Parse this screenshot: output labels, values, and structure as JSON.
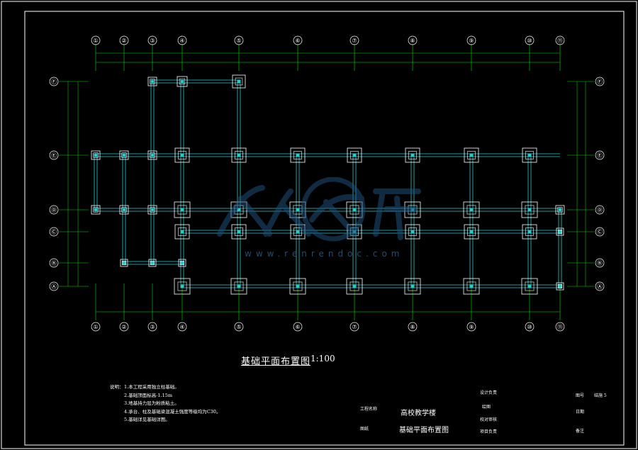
{
  "drawing": {
    "title": "基础平面布置图",
    "scale": "1:100",
    "col_axes": [
      "①",
      "②",
      "③",
      "④",
      "⑤",
      "⑥",
      "⑦",
      "⑧",
      "⑨",
      "⑩",
      "⑪"
    ],
    "row_axes": [
      "Ⓕ",
      "Ⓔ",
      "Ⓓ",
      "Ⓒ",
      "Ⓑ",
      "Ⓐ"
    ],
    "colors": {
      "axis": "#00e000",
      "beam": "#2ec8c8",
      "footing": "#ffffff",
      "frame": "#ffffff",
      "watermark": "#1f4f7a"
    }
  },
  "notes": {
    "heading": "说明：",
    "lines": [
      "1.本工程采用独立柱基础。",
      "2.基础顶面标高-1.15m",
      "3.地基持力层为粉质粘土。",
      "4.承台、柱及基础梁混凝土强度等级均为C30。",
      "5.基础详见基础详图。"
    ]
  },
  "title_block": {
    "project_label": "工程名称",
    "project_name": "高校教学楼",
    "drawing_label": "图纸",
    "drawing_name": "基础平面布置图",
    "role_labels": [
      "设计负责",
      "绘图",
      "校对审核",
      "项目负责"
    ],
    "right_labels": [
      "图号",
      "日期",
      "备注"
    ],
    "sheet_no": "结施 5"
  },
  "watermark": {
    "text": "www.renrendoc.com"
  }
}
